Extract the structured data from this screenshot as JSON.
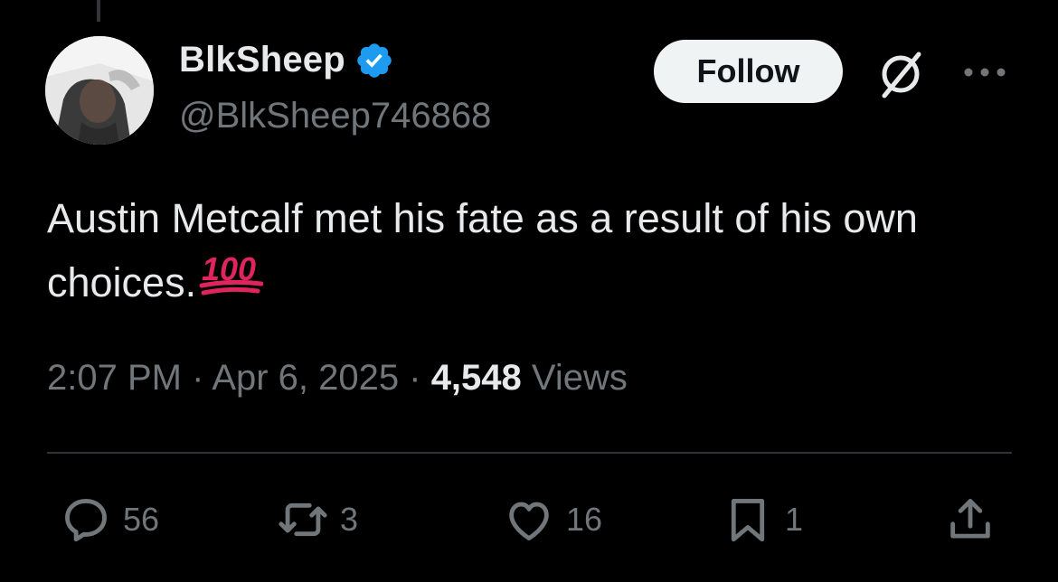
{
  "author": {
    "display_name": "BlkSheep",
    "handle": "@BlkSheep746868"
  },
  "follow_button": {
    "label": "Follow"
  },
  "tweet": {
    "text": "Austin Metcalf met his fate as a result of his own choices.",
    "emoji": "💯"
  },
  "meta": {
    "time": "2:07 PM",
    "separator": " · ",
    "date": "Apr 6, 2025",
    "views_count": "4,548",
    "views_label": "Views"
  },
  "actions": {
    "replies": "56",
    "reposts": "3",
    "likes": "16",
    "bookmarks": "1"
  },
  "colors": {
    "background": "#000000",
    "text_primary": "#e7e9ea",
    "text_secondary": "#71767b",
    "verified_blue": "#1d9bf0",
    "emoji_red": "#e0245e"
  },
  "icons": [
    "verified-badge-icon",
    "grok-icon",
    "more-icon",
    "reply-icon",
    "repost-icon",
    "like-icon",
    "bookmark-icon",
    "share-icon"
  ]
}
